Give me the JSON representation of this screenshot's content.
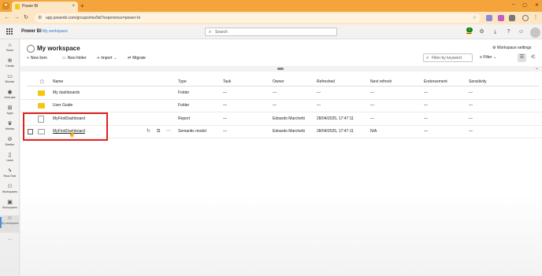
{
  "browser": {
    "tab_title": "Power BI",
    "url": "app.powerbi.com/groups/me/list?experience=power-bi"
  },
  "header": {
    "brand": "Power BI",
    "breadcrumb": "My workspace",
    "search_placeholder": "Search",
    "notification_count": "2"
  },
  "leftnav": {
    "items": [
      {
        "label": "Home",
        "icon": "home-icon"
      },
      {
        "label": "Create",
        "icon": "plus-circle-icon"
      },
      {
        "label": "Browse",
        "icon": "folder-icon"
      },
      {
        "label": "OneLake",
        "icon": "onelake-icon"
      },
      {
        "label": "Apps",
        "icon": "apps-icon"
      },
      {
        "label": "Metrics",
        "icon": "trophy-icon"
      },
      {
        "label": "Monitor",
        "icon": "monitor-icon"
      },
      {
        "label": "Learn",
        "icon": "book-icon"
      },
      {
        "label": "Real-Time",
        "icon": "lightning-icon"
      },
      {
        "label": "Workspaces",
        "icon": "workspaces-icon"
      },
      {
        "label": "Workspaces",
        "icon": "workspaces2-icon"
      },
      {
        "label": "My workspace",
        "icon": "person-icon"
      }
    ],
    "more": "..."
  },
  "workspace": {
    "title": "My workspace",
    "settings": "Workspace settings"
  },
  "commands": {
    "new_item": "New item",
    "new_folder": "New folder",
    "import": "Import",
    "migrate": "Migrate",
    "filter_placeholder": "Filter by keyword",
    "filter": "Filter"
  },
  "table": {
    "headers": [
      "Name",
      "Type",
      "Task",
      "Owner",
      "Refreshed",
      "Next refresh",
      "Endorsement",
      "Sensitivity"
    ],
    "rows": [
      {
        "name": "My dashboards",
        "type": "Folder",
        "task": "—",
        "owner": "—",
        "refreshed": "—",
        "next": "—",
        "endorsement": "—",
        "sensitivity": "—"
      },
      {
        "name": "User Guide",
        "type": "Folder",
        "task": "—",
        "owner": "—",
        "refreshed": "—",
        "next": "—",
        "endorsement": "—",
        "sensitivity": "—"
      },
      {
        "name": "MyFirstDashboard",
        "type": "Report",
        "task": "—",
        "owner": "Edoardo Marchetti",
        "refreshed": "28/04/2025, 17:47:11",
        "next": "—",
        "endorsement": "—",
        "sensitivity": "—"
      },
      {
        "name": "MyFirstDashboard",
        "type": "Semantic model",
        "task": "—",
        "owner": "Edoardo Marchetti",
        "refreshed": "28/04/2025, 17:47:11",
        "next": "N/A",
        "endorsement": "—",
        "sensitivity": "—"
      }
    ]
  },
  "colors": {
    "browser_tab_strip": "#f4a43a",
    "accent": "#2b7cd3",
    "highlight_box": "#e02020",
    "folder": "#f2c811"
  }
}
